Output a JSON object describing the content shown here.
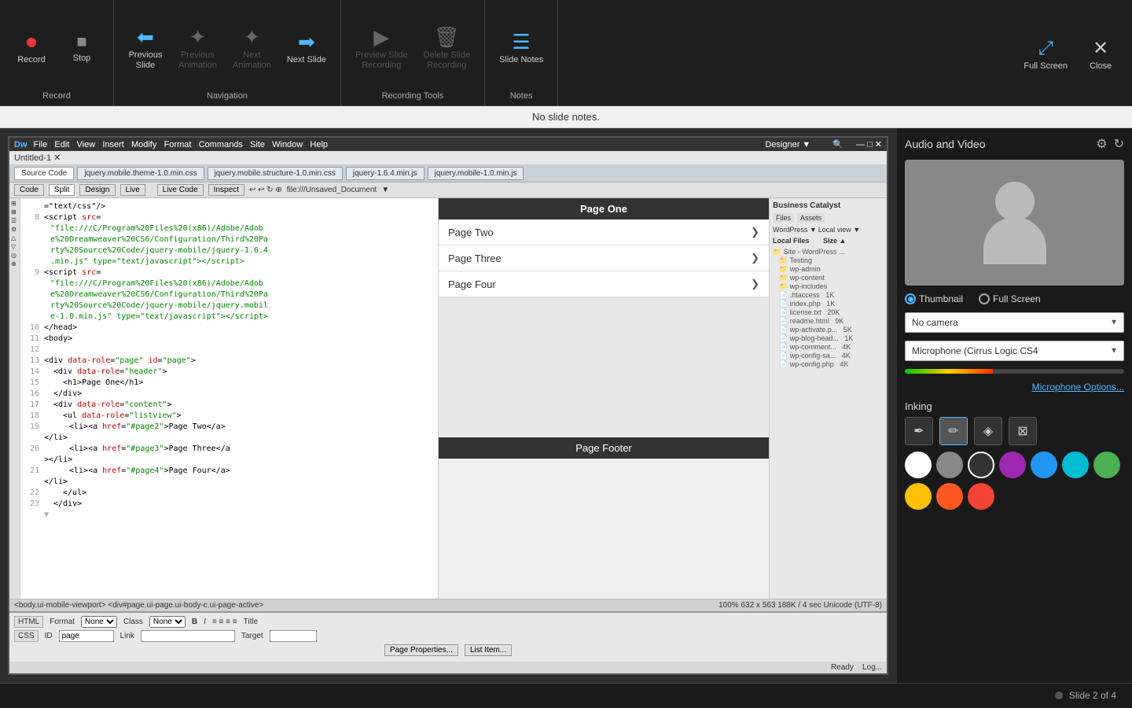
{
  "toolbar": {
    "record_section_label": "Record",
    "navigation_section_label": "Navigation",
    "recording_tools_section_label": "Recording Tools",
    "notes_section_label": "Notes",
    "buttons": {
      "record_label": "Record",
      "stop_label": "Stop",
      "previous_slide_label_line1": "Previous",
      "previous_slide_label_line2": "Slide",
      "previous_animation_label_line1": "Previous",
      "previous_animation_label_line2": "Animation",
      "next_animation_label_line1": "Next",
      "next_animation_label_line2": "Animation",
      "next_slide_label": "Next Slide",
      "preview_slide_recording_label_line1": "Preview Slide",
      "preview_slide_recording_label_line2": "Recording",
      "delete_slide_recording_label_line1": "Delete Slide",
      "delete_slide_recording_label_line2": "Recording",
      "slide_notes_label": "Slide Notes",
      "full_screen_label": "Full Screen",
      "close_label": "Close"
    }
  },
  "slide_notes_bar": {
    "text": "No slide notes."
  },
  "dw_mock": {
    "titlebar": "Dw  File  Edit  View  Insert  Modify  Format  Commands  Site  Window  Help",
    "untitled_tab": "Untitled-1",
    "source_code_tab": "Source Code",
    "css_tab": "jquery.mobile.theme-1.0.min.css",
    "structure_tab": "jquery.mobile.structure-1.0.min.css",
    "js_tab": "jquery-1.6.4.min.js",
    "js2_tab": "jquery.mobile-1.0.min.js",
    "view_tabs": [
      "Code",
      "Split",
      "Design",
      "Live",
      "Live Code",
      "Inspect"
    ],
    "page_items": [
      "Page One",
      "Page Two",
      "Page Three",
      "Page Four"
    ],
    "page_footer": "Page Footer",
    "statusbar": "100%  632 x 563  188K / 4 sec  Unicode (UTF-8)",
    "ready": "Ready"
  },
  "right_panel": {
    "title": "Audio and Video",
    "camera_thumbnail_label": "Thumbnail",
    "camera_fullscreen_label": "Full Screen",
    "camera_dropdown_value": "No camera",
    "camera_dropdown_options": [
      "No camera"
    ],
    "microphone_dropdown_value": "Microphone (Cirrus Logic CS4",
    "microphone_options_link": "Microphone Options...",
    "inking_label": "Inking",
    "tools": [
      {
        "name": "pen-tool",
        "icon": "✒",
        "active": false
      },
      {
        "name": "highlighter-tool",
        "icon": "✏",
        "active": true
      },
      {
        "name": "eraser-tool",
        "icon": "◈",
        "active": false
      },
      {
        "name": "clear-tool",
        "icon": "⊠",
        "active": false
      }
    ],
    "colors": [
      {
        "name": "white",
        "hex": "#ffffff"
      },
      {
        "name": "gray",
        "hex": "#888888"
      },
      {
        "name": "black",
        "hex": "#333333",
        "active": true
      },
      {
        "name": "purple",
        "hex": "#9c27b0"
      },
      {
        "name": "blue",
        "hex": "#2196f3"
      },
      {
        "name": "cyan",
        "hex": "#00bcd4"
      },
      {
        "name": "green",
        "hex": "#4caf50"
      },
      {
        "name": "yellow",
        "hex": "#ffc107"
      },
      {
        "name": "orange",
        "hex": "#ff5722"
      },
      {
        "name": "red",
        "hex": "#f44336"
      }
    ]
  },
  "status_bar": {
    "text": "Slide 2 of 4"
  }
}
